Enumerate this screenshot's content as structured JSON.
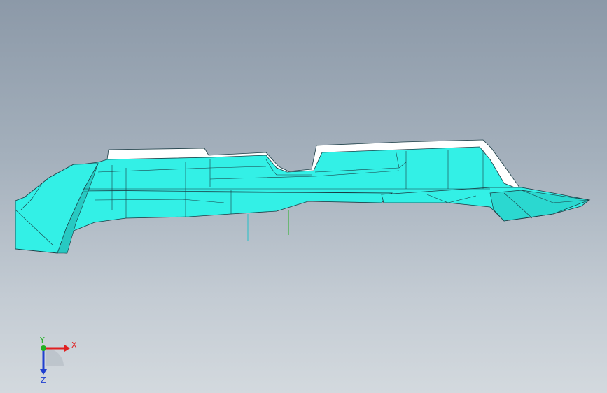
{
  "viewport": {
    "background_top": "#8c99a8",
    "background_bottom": "#d3d9de"
  },
  "model": {
    "body_color": "#33f0e6",
    "highlight_color": "#ffffff",
    "edge_color": "#1a3c44"
  },
  "triad": {
    "x_label": "X",
    "y_label": "Y",
    "z_label": "Z",
    "x_color": "#e02020",
    "y_color": "#22b022",
    "z_color": "#2040d0"
  }
}
